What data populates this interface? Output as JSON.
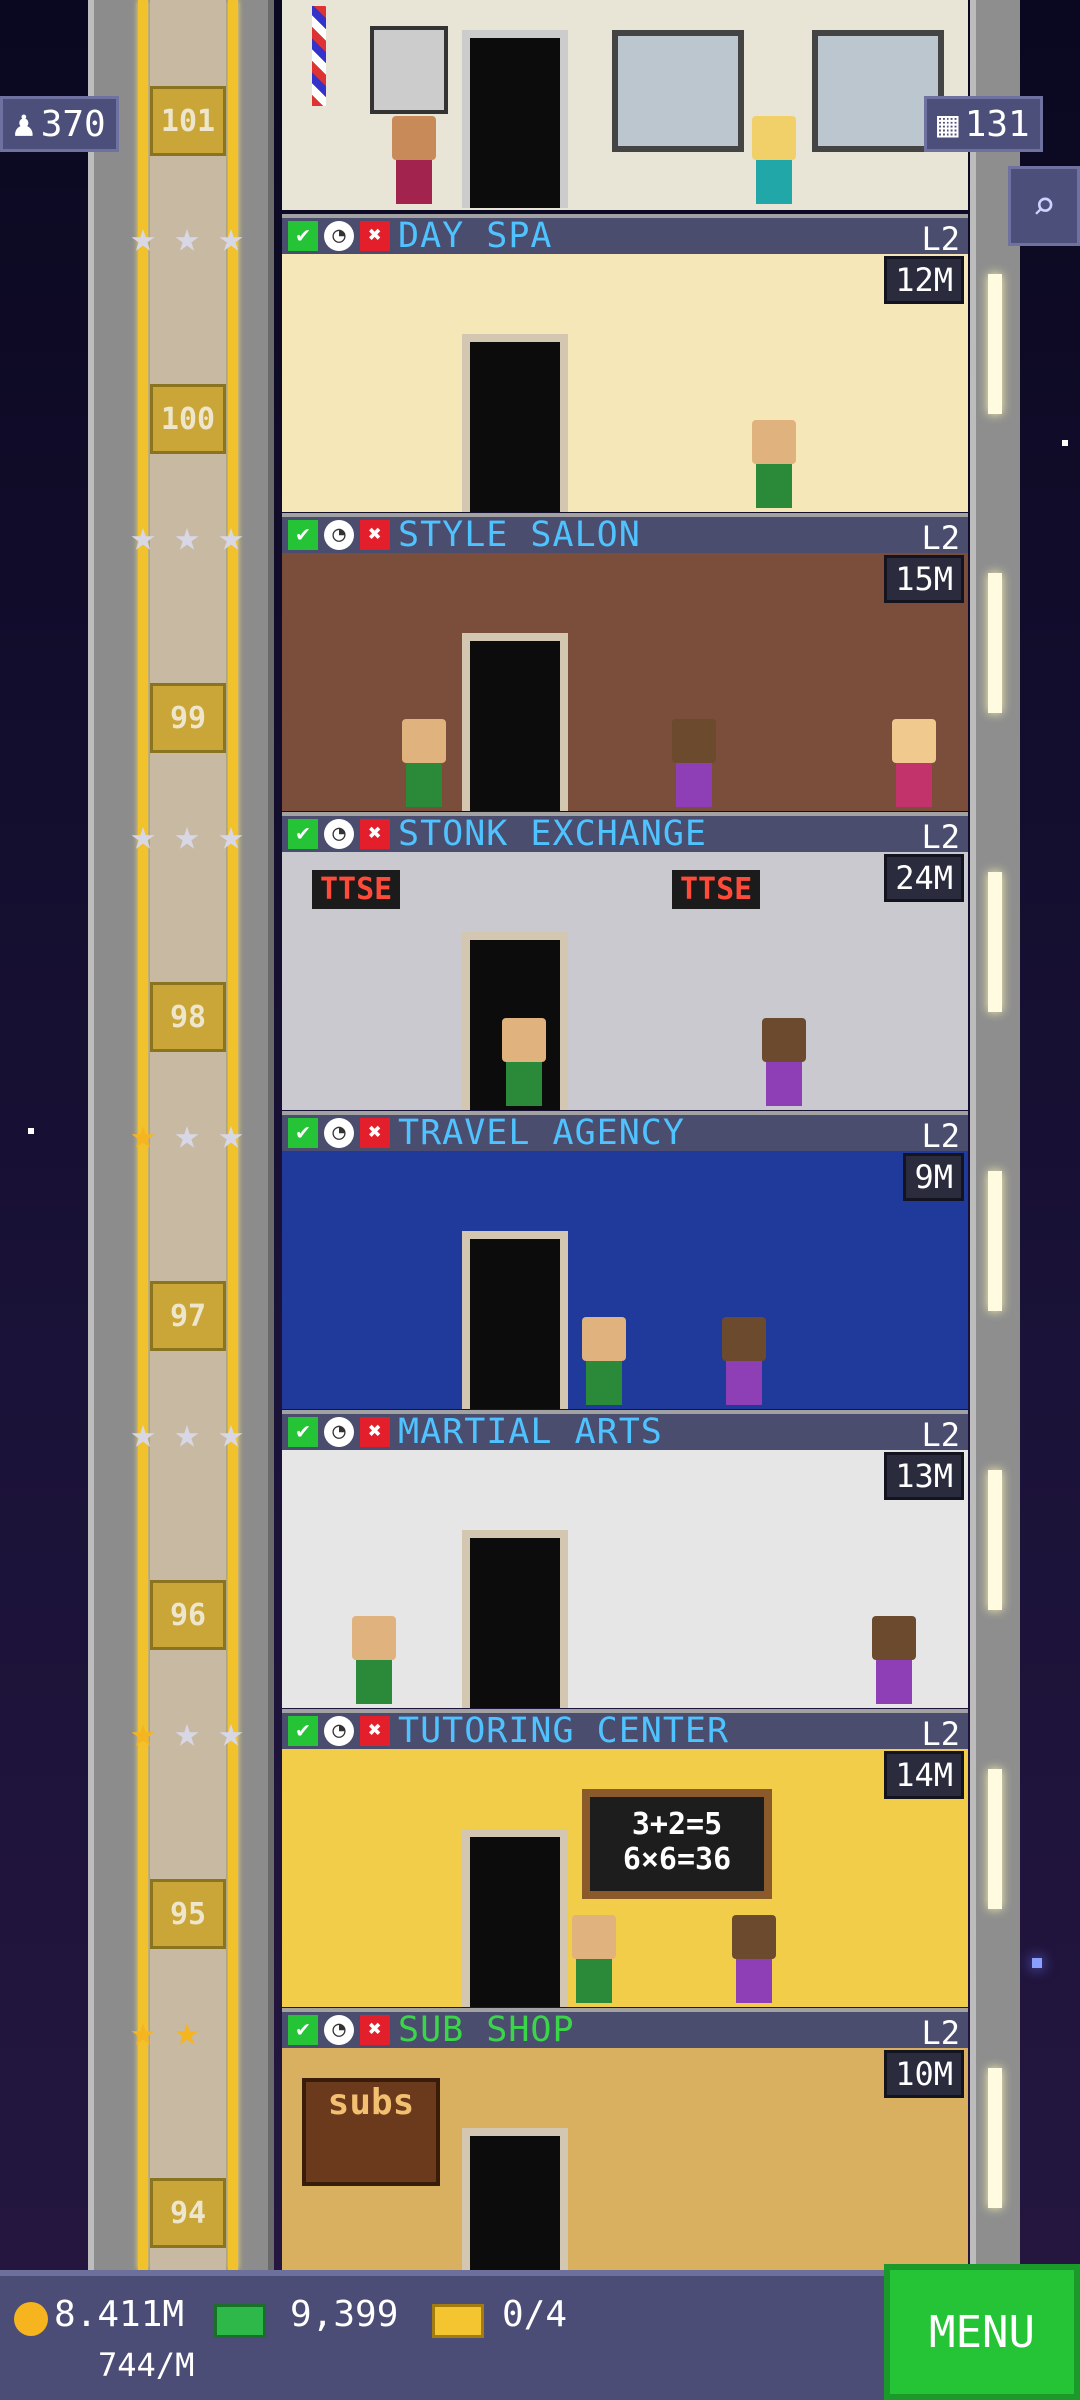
{
  "top": {
    "population": "370",
    "population_icon": "person-icon",
    "floors_count": "131",
    "floors_icon": "building-icon",
    "search_icon": "magnifier-icon",
    "current_floor_number": "101"
  },
  "floors": [
    {
      "number": "100",
      "name": "DAY SPA",
      "level": "L2",
      "price": "12M",
      "stars": [
        1,
        1,
        1
      ],
      "theme": "#f6e7b8"
    },
    {
      "number": "99",
      "name": "STYLE SALON",
      "level": "L2",
      "price": "15M",
      "stars": [
        1,
        1,
        1
      ],
      "theme": "#7a4e3a"
    },
    {
      "number": "98",
      "name": "STONK EXCHANGE",
      "level": "L2",
      "price": "24M",
      "stars": [
        1,
        1,
        1
      ],
      "theme": "#c9c9cf"
    },
    {
      "number": "97",
      "name": "TRAVEL AGENCY",
      "level": "L2",
      "price": "9M",
      "stars": [
        2,
        1,
        1
      ],
      "theme": "#1f3a9a"
    },
    {
      "number": "96",
      "name": "MARTIAL ARTS",
      "level": "L2",
      "price": "13M",
      "stars": [
        1,
        1,
        1
      ],
      "theme": "#e6e6e6"
    },
    {
      "number": "95",
      "name": "TUTORING CENTER",
      "level": "L2",
      "price": "14M",
      "stars": [
        2,
        1,
        1
      ],
      "theme": "#f1cd4a"
    },
    {
      "number": "94",
      "name": "SUB SHOP",
      "level": "L2",
      "price": "10M",
      "stars": [
        2,
        2
      ],
      "theme": "#d9b060"
    }
  ],
  "signs": {
    "stonk_left": "TTSE",
    "stonk_right": "TTSE",
    "tutoring_board_line1": "3+2=5",
    "tutoring_board_line2": "6×6=36",
    "sub_sign": "subs"
  },
  "hud": {
    "coins": "8.411M",
    "coin_rate": "744/M",
    "bux": "9,399",
    "tickets": "0/4",
    "menu_label": "MENU"
  }
}
